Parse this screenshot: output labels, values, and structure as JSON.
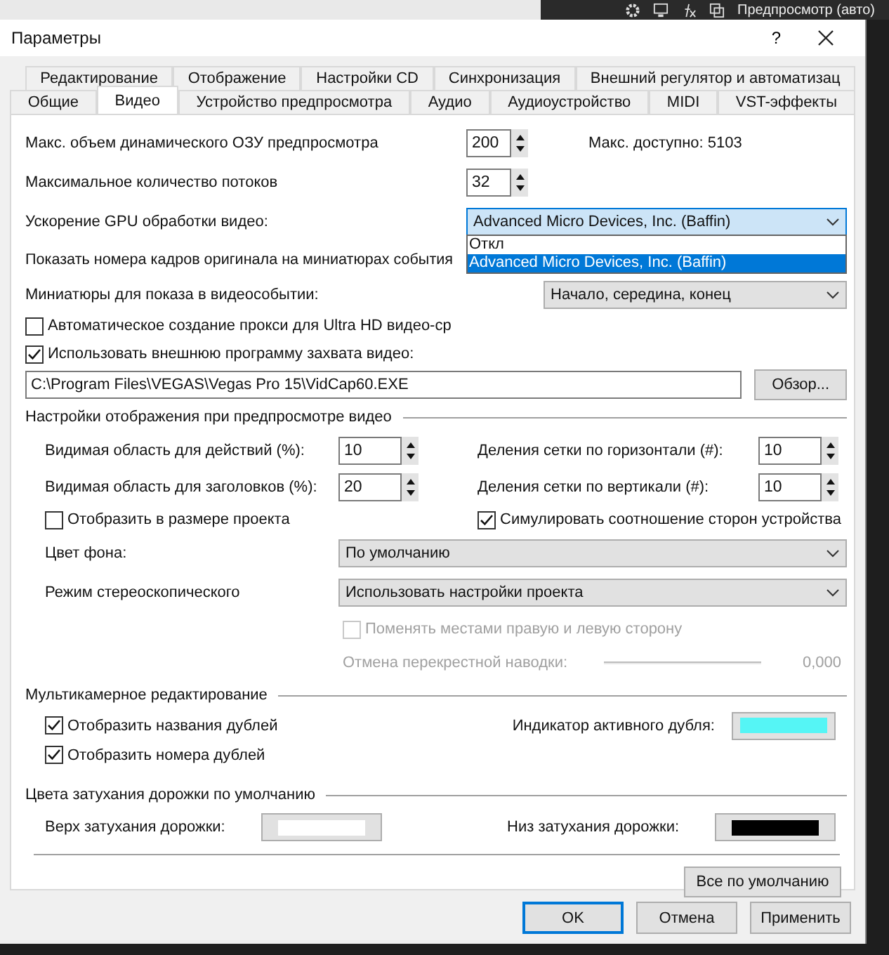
{
  "app_toolbar": {
    "label": "Предпросмотр (авто)"
  },
  "window": {
    "title": "Параметры",
    "help": "?"
  },
  "tab_rows": [
    {
      "tabs": [
        {
          "label": "Редактирование",
          "selected": false
        },
        {
          "label": "Отображение",
          "selected": false
        },
        {
          "label": "Настройки CD",
          "selected": false
        },
        {
          "label": "Синхронизация",
          "selected": false
        },
        {
          "label": "Внешний регулятор и автоматизац",
          "selected": false
        }
      ]
    },
    {
      "tabs": [
        {
          "label": "Общие",
          "selected": false
        },
        {
          "label": "Видео",
          "selected": true
        },
        {
          "label": "Устройство предпросмотра",
          "selected": false
        },
        {
          "label": "Аудио",
          "selected": false
        },
        {
          "label": "Аудиоустройство",
          "selected": false
        },
        {
          "label": "MIDI",
          "selected": false
        },
        {
          "label": "VST-эффекты",
          "selected": false
        }
      ]
    }
  ],
  "preview_ram": {
    "label": "Макс. объем динамического ОЗУ предпросмотра",
    "value": "200",
    "max_label": "Макс. доступно: 5103"
  },
  "threads": {
    "label": "Максимальное количество потоков",
    "value": "32"
  },
  "gpu": {
    "label": "Ускорение GPU обработки видео:",
    "value": "Advanced Micro Devices, Inc. (Baffin)",
    "expanded": true,
    "options": [
      {
        "label": "Откл",
        "selected": false
      },
      {
        "label": "Advanced Micro Devices, Inc. (Baffin)",
        "selected": true
      }
    ]
  },
  "frame_numbers": {
    "label": "Показать номера кадров оригинала на миниатюрах события"
  },
  "thumbnails": {
    "label": "Миниатюры для показа в видеособытии:",
    "value": "Начало, середина, конец"
  },
  "checkboxes": [
    {
      "label": "Автоматическое создание прокси для Ultra HD видео-ср",
      "checked": false
    },
    {
      "label": "Использовать внешнюю программу захвата видео:",
      "checked": true
    }
  ],
  "capture_path": {
    "value": "C:\\Program Files\\VEGAS\\Vegas Pro 15\\VidCap60.EXE",
    "browse": "Обзор..."
  },
  "display_group": {
    "title": "Настройки отображения при предпросмотре видео",
    "grid": [
      {
        "left": {
          "kind": "spin",
          "label": "Видимая область для действий (%):",
          "value": "10"
        },
        "right": {
          "kind": "spin",
          "label": "Деления сетки по горизонтали (#):",
          "value": "10"
        }
      },
      {
        "left": {
          "kind": "spin",
          "label": "Видимая область для заголовков (%):",
          "value": "20"
        },
        "right": {
          "kind": "spin",
          "label": "Деления сетки по вертикали (#):",
          "value": "10"
        }
      },
      {
        "left": {
          "kind": "checkbox",
          "label": "Отобразить в размере проекта",
          "checked": false
        },
        "right": {
          "kind": "checkbox",
          "label": "Симулировать соотношение сторон устройства",
          "checked": true
        }
      }
    ],
    "selects": [
      {
        "label": "Цвет фона:",
        "value": "По умолчанию"
      },
      {
        "label": "Режим стереоскопического",
        "value": "Использовать настройки проекта"
      }
    ],
    "swap": {
      "label": "Поменять местами правую и левую сторону",
      "checked": false,
      "disabled": true
    },
    "crosstalk": {
      "label": "Отмена перекрестной наводки:",
      "reading": "0,000",
      "disabled": true
    }
  },
  "multicam": {
    "title": "Мультикамерное редактирование",
    "checkboxes": [
      {
        "label": "Отобразить названия дублей",
        "checked": true
      },
      {
        "label": "Отобразить номера дублей",
        "checked": true
      }
    ],
    "indicator": {
      "label": "Индикатор активного дубля:",
      "color": "#55f5f5"
    }
  },
  "fade": {
    "title": "Цвета затухания дорожки по умолчанию",
    "swatches": [
      {
        "label": "Верх затухания дорожки:",
        "color": "#ffffff"
      },
      {
        "label": "Низ затухания дорожки:",
        "color": "#000000"
      }
    ]
  },
  "defaults_button": "Все по умолчанию",
  "buttons": [
    {
      "label": "OK",
      "default": true
    },
    {
      "label": "Отмена",
      "default": false
    },
    {
      "label": "Применить",
      "default": false
    }
  ]
}
